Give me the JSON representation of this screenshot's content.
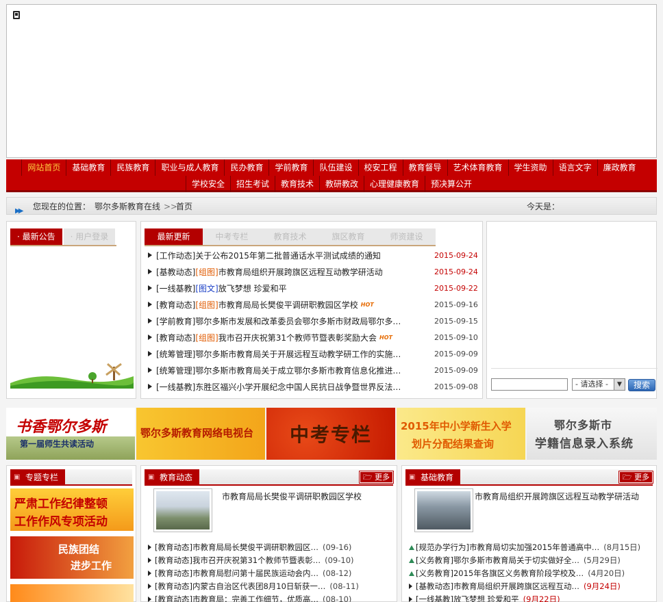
{
  "nav": {
    "row1": [
      "网站首页",
      "基础教育",
      "民族教育",
      "职业与成人教育",
      "民办教育",
      "学前教育",
      "队伍建设",
      "校安工程",
      "教育督导",
      "艺术体育教育",
      "学生资助",
      "语言文字",
      "廉政教育"
    ],
    "row2": [
      "学校安全",
      "招生考试",
      "教育技术",
      "教研教改",
      "心理健康教育",
      "预决算公开"
    ]
  },
  "location": {
    "prefix": "您现在的位置：",
    "home": "鄂尔多斯教育在线",
    "sep": ">>",
    "current": "首页",
    "today": "今天是："
  },
  "notice_tabs": {
    "active": "最新公告",
    "inactive": "用户登录"
  },
  "news_tabs": [
    "最新更新",
    "中考专栏",
    "教育技术",
    "旗区教育",
    "师资建设"
  ],
  "news": [
    {
      "cat": "[工作动态]",
      "tag": "",
      "text": "关于公布2015年第二批普通话水平测试成绩的通知",
      "hot": "",
      "date": "2015-09-24",
      "red": true
    },
    {
      "cat": "[基教动态]",
      "tag": "[组图]",
      "text": "市教育局组织开展跨旗区远程互动教学研活动",
      "hot": "",
      "date": "2015-09-24",
      "red": true
    },
    {
      "cat": "[一线基教]",
      "tag": "[图文]",
      "text": "放飞梦想 珍爱和平",
      "hot": "",
      "date": "2015-09-22",
      "red": true
    },
    {
      "cat": "[教育动态]",
      "tag": "[组图]",
      "text": "市教育局局长樊俊平调研职教园区学校",
      "hot": "HOT",
      "date": "2015-09-16",
      "red": false
    },
    {
      "cat": "[学前教育]",
      "tag": "",
      "text": "鄂尔多斯市发展和改革委员会鄂尔多斯市财政局鄂尔多…",
      "hot": "HOT",
      "date": "2015-09-15",
      "red": false
    },
    {
      "cat": "[教育动态]",
      "tag": "[组图]",
      "text": "我市召开庆祝第31个教师节暨表彰奖励大会",
      "hot": "HOT",
      "date": "2015-09-10",
      "red": false
    },
    {
      "cat": "[统筹管理]",
      "tag": "",
      "text": "鄂尔多斯市教育局关于开展远程互动教学研工作的实施…",
      "hot": "HOT",
      "date": "2015-09-09",
      "red": false
    },
    {
      "cat": "[统筹管理]",
      "tag": "",
      "text": "鄂尔多斯市教育局关于成立鄂尔多斯市教育信息化推进…",
      "hot": "HOT",
      "date": "2015-09-09",
      "red": false
    },
    {
      "cat": "[一线基教]",
      "tag": "",
      "text": "东胜区福兴小学开展纪念中国人民抗日战争暨世界反法…",
      "hot": "HOT",
      "date": "2015-09-08",
      "red": false
    }
  ],
  "search": {
    "select": "- 请选择 -",
    "button": "搜索"
  },
  "promos": {
    "p1_big": "书香鄂尔多斯",
    "p1_small": "第一届师生共读活动",
    "p2": "鄂尔多斯教育网络电视台",
    "p3": "中考专栏",
    "p4_line1": "2015年中小学新生入学",
    "p4_line2": "划片分配结果查询",
    "p5_line1": "鄂尔多斯市",
    "p5_line2": "学籍信息录入系统"
  },
  "topics": {
    "label": "专题专栏",
    "t1_line1": "严肃工作纪律整顿",
    "t1_line2": "工作作风专项活动",
    "t2_line1": "民族团结",
    "t2_line2": "进步工作"
  },
  "edu": {
    "label": "教育动态",
    "more": "更多",
    "feature": "市教育局局长樊俊平调研职教园区学校",
    "items": [
      {
        "text": "[教育动态]市教育局局长樊俊平调研职教园区…",
        "date": "(09-16)"
      },
      {
        "text": "[教育动态]我市召开庆祝第31个教师节暨表彰…",
        "date": "(09-10)"
      },
      {
        "text": "[教育动态]市教育局慰问第十届民族运动会内…",
        "date": "(08-12)"
      },
      {
        "text": "[教育动态]内蒙古自治区代表团8月10日斩获一…",
        "date": "(08-11)"
      },
      {
        "text": "[教育动态]市教育局：完善工作细节，优质高…",
        "date": "(08-10)"
      }
    ]
  },
  "basic": {
    "label": "基础教育",
    "more": "更多",
    "feature": "市教育局组织开展跨旗区远程互动教学研活动",
    "items": [
      {
        "text": "[规范办学行为]市教育局切实加强2015年普通高中…",
        "date": "(8月15日)",
        "red": false,
        "up": true
      },
      {
        "text": "[义务教育]鄂尔多斯市教育局关于切实做好全…",
        "date": "(5月29日)",
        "red": false,
        "up": true
      },
      {
        "text": "[义务教育]2015年各旗区义务教育阶段学校及…",
        "date": "(4月20日)",
        "red": false,
        "up": true
      },
      {
        "text": "[基教动态]市教育局组织开展跨旗区远程互动…",
        "date": "(9月24日)",
        "red": true,
        "up": false
      },
      {
        "text": "[一线基教]放飞梦想 珍爱和平",
        "date": "(9月22日)",
        "red": true,
        "up": false
      }
    ]
  }
}
